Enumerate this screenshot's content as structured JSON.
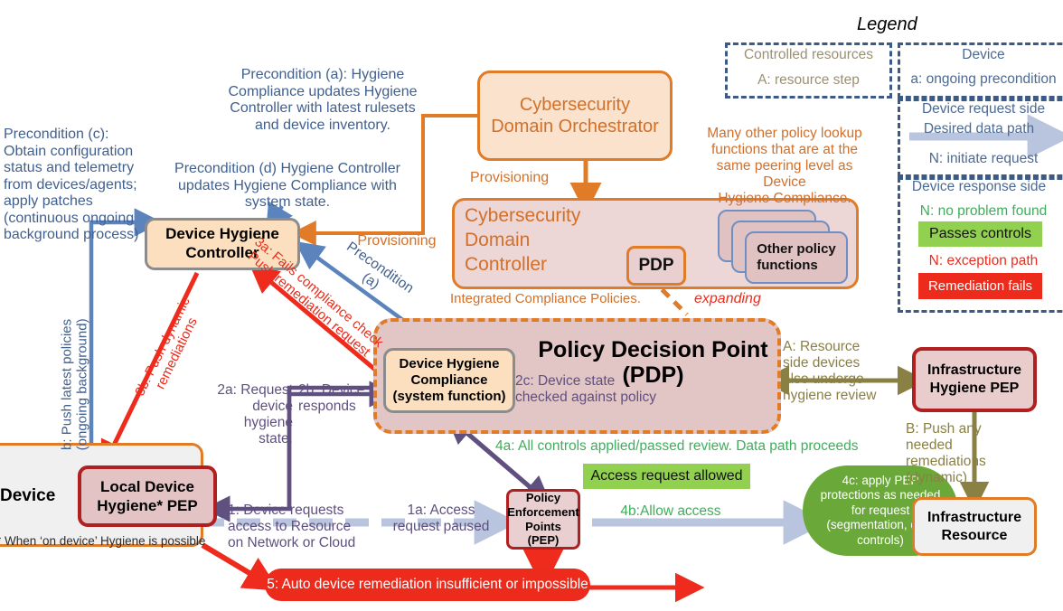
{
  "legend": {
    "title": "Legend",
    "controlled_resources": "Controlled resources",
    "resource_step": "A: resource step",
    "device": "Device",
    "ongoing_precondition": "a: ongoing precondition",
    "device_request_side": "Device request side",
    "desired_data_path": "Desired data path",
    "initiate_request": "N: initiate request",
    "device_response_side": "Device response side",
    "no_problem_found": "N: no problem found",
    "passes_controls": "Passes controls",
    "exception_path": "N: exception path",
    "remediation_fails": "Remediation fails"
  },
  "nodes": {
    "orchestrator": "Cybersecurity\nDomain Orchestrator",
    "cdc_line1": "Cybersecurity",
    "cdc_line2": "Domain",
    "cdc_line3": "Controller",
    "cdc_caption": "Integrated Compliance Policies.",
    "pdp_chip": "PDP",
    "other_policy_functions": "Other policy\nfunctions",
    "device_hygiene_controller": "Device Hygiene\nController",
    "device_hygiene_compliance": "Device Hygiene\nCompliance\n(system function)",
    "policy_decision_point": "Policy Decision Point\n(PDP)",
    "device": "Device",
    "device_footnote": "* When ‘on device’ Hygiene is possible",
    "local_device_hygiene_pep": "Local Device\nHygiene* PEP",
    "policy_enforcement_points": "Policy\nEnforcement\nPoints\n(PEP)",
    "infrastructure_hygiene_pep": "Infrastructure\nHygiene PEP",
    "infrastructure_resource": "Infrastructure\nResource",
    "access_request_allowed": "Access request allowed",
    "apply_pep_protections": "4c: apply PEP\nprotections as needed\nfor request\n(segmentation, data\ncontrols)",
    "auto_remediation": "5: Auto device remediation insufficient or impossible"
  },
  "annotations": {
    "precondition_a": "Precondition (a): Hygiene\nCompliance updates Hygiene\nController with latest rulesets\nand device inventory.",
    "precondition_c": "Precondition (c):\nObtain configuration\nstatus and telemetry\nfrom devices/agents;\napply patches\n(continuous ongoing\nbackground process)",
    "precondition_d": "Precondition (d) Hygiene Controller\nupdates Hygiene Compliance with\nsystem state.",
    "provisioning_top": "Provisioning",
    "provisioning_left": "Provisioning",
    "many_other_policy": "Many other policy lookup\nfunctions that are at the\nsame peering level as Device\nHygiene Compliance.",
    "expanding": "expanding",
    "precondition_a_arrow": "Precondition\n(a)",
    "step_3a": "3a: Fails compliance check\nPush remediation request",
    "step_3b": "3b: Push dynamic\nremediations",
    "step_b": "b: Push latest policies\n(ongoing background)",
    "step_2a": "2a: Request\ndevice\nhygiene\nstate.",
    "step_2b": "2b: Device\nresponds",
    "step_2c": "2c: Device state\nchecked against policy",
    "step_1": "1: Device requests\naccess to Resource\non Network or Cloud",
    "step_1a": "1a: Access\nrequest paused",
    "step_4a": "4a: All controls applied/passed review.  Data path proceeds",
    "step_4b": "4b:Allow access",
    "step_A": "A: Resource\nside devices\nalso undergo\nhygiene review",
    "step_B": "B: Push any\nneeded\nremediations\n(dynamic)"
  },
  "colors": {
    "orange": "#e07b28",
    "blue": "#5b84bd",
    "red": "#ee2b1c",
    "dark_red": "#b02020",
    "purple": "#5f5080",
    "green": "#3fae5a",
    "olive": "#8a8044",
    "light_blue_arrow": "#b9c4de",
    "legend_blue": "#3c5a86",
    "chip_green": "#92d050",
    "blob_green": "#6aa939"
  }
}
